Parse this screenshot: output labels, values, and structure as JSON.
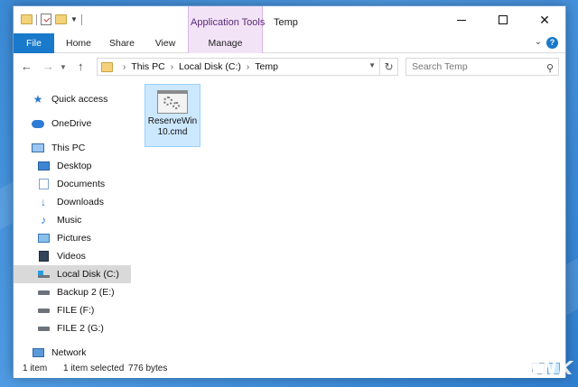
{
  "window": {
    "title": "Temp",
    "context_tab_group": "Application Tools"
  },
  "ribbon": {
    "tabs": [
      "File",
      "Home",
      "Share",
      "View",
      "Manage"
    ]
  },
  "address": {
    "crumbs": [
      "This PC",
      "Local Disk (C:)",
      "Temp"
    ]
  },
  "search": {
    "placeholder": "Search Temp"
  },
  "sidebar": {
    "items": [
      {
        "label": "Quick access",
        "icon": "star-icon"
      },
      {
        "label": "OneDrive",
        "icon": "cloud-icon"
      },
      {
        "label": "This PC",
        "icon": "computer-icon"
      },
      {
        "label": "Desktop",
        "icon": "desktop-icon"
      },
      {
        "label": "Documents",
        "icon": "documents-icon"
      },
      {
        "label": "Downloads",
        "icon": "download-icon"
      },
      {
        "label": "Music",
        "icon": "music-icon"
      },
      {
        "label": "Pictures",
        "icon": "pictures-icon"
      },
      {
        "label": "Videos",
        "icon": "videos-icon"
      },
      {
        "label": "Local Disk (C:)",
        "icon": "system-drive-icon",
        "selected": true
      },
      {
        "label": "Backup 2 (E:)",
        "icon": "drive-icon"
      },
      {
        "label": "FILE (F:)",
        "icon": "drive-icon"
      },
      {
        "label": "FILE 2 (G:)",
        "icon": "drive-icon"
      },
      {
        "label": "Network",
        "icon": "network-icon"
      }
    ]
  },
  "content": {
    "files": [
      {
        "name_line1": "ReserveWin",
        "name_line2": "10.cmd",
        "icon": "cmd-script-icon",
        "selected": true
      }
    ]
  },
  "status": {
    "count": "1 item",
    "selected": "1 item selected",
    "size": "776 bytes"
  },
  "watermark": "GENK",
  "colors": {
    "accent": "#1979ca",
    "context_tab": "#f2e3f6",
    "selection": "#cce8ff"
  }
}
